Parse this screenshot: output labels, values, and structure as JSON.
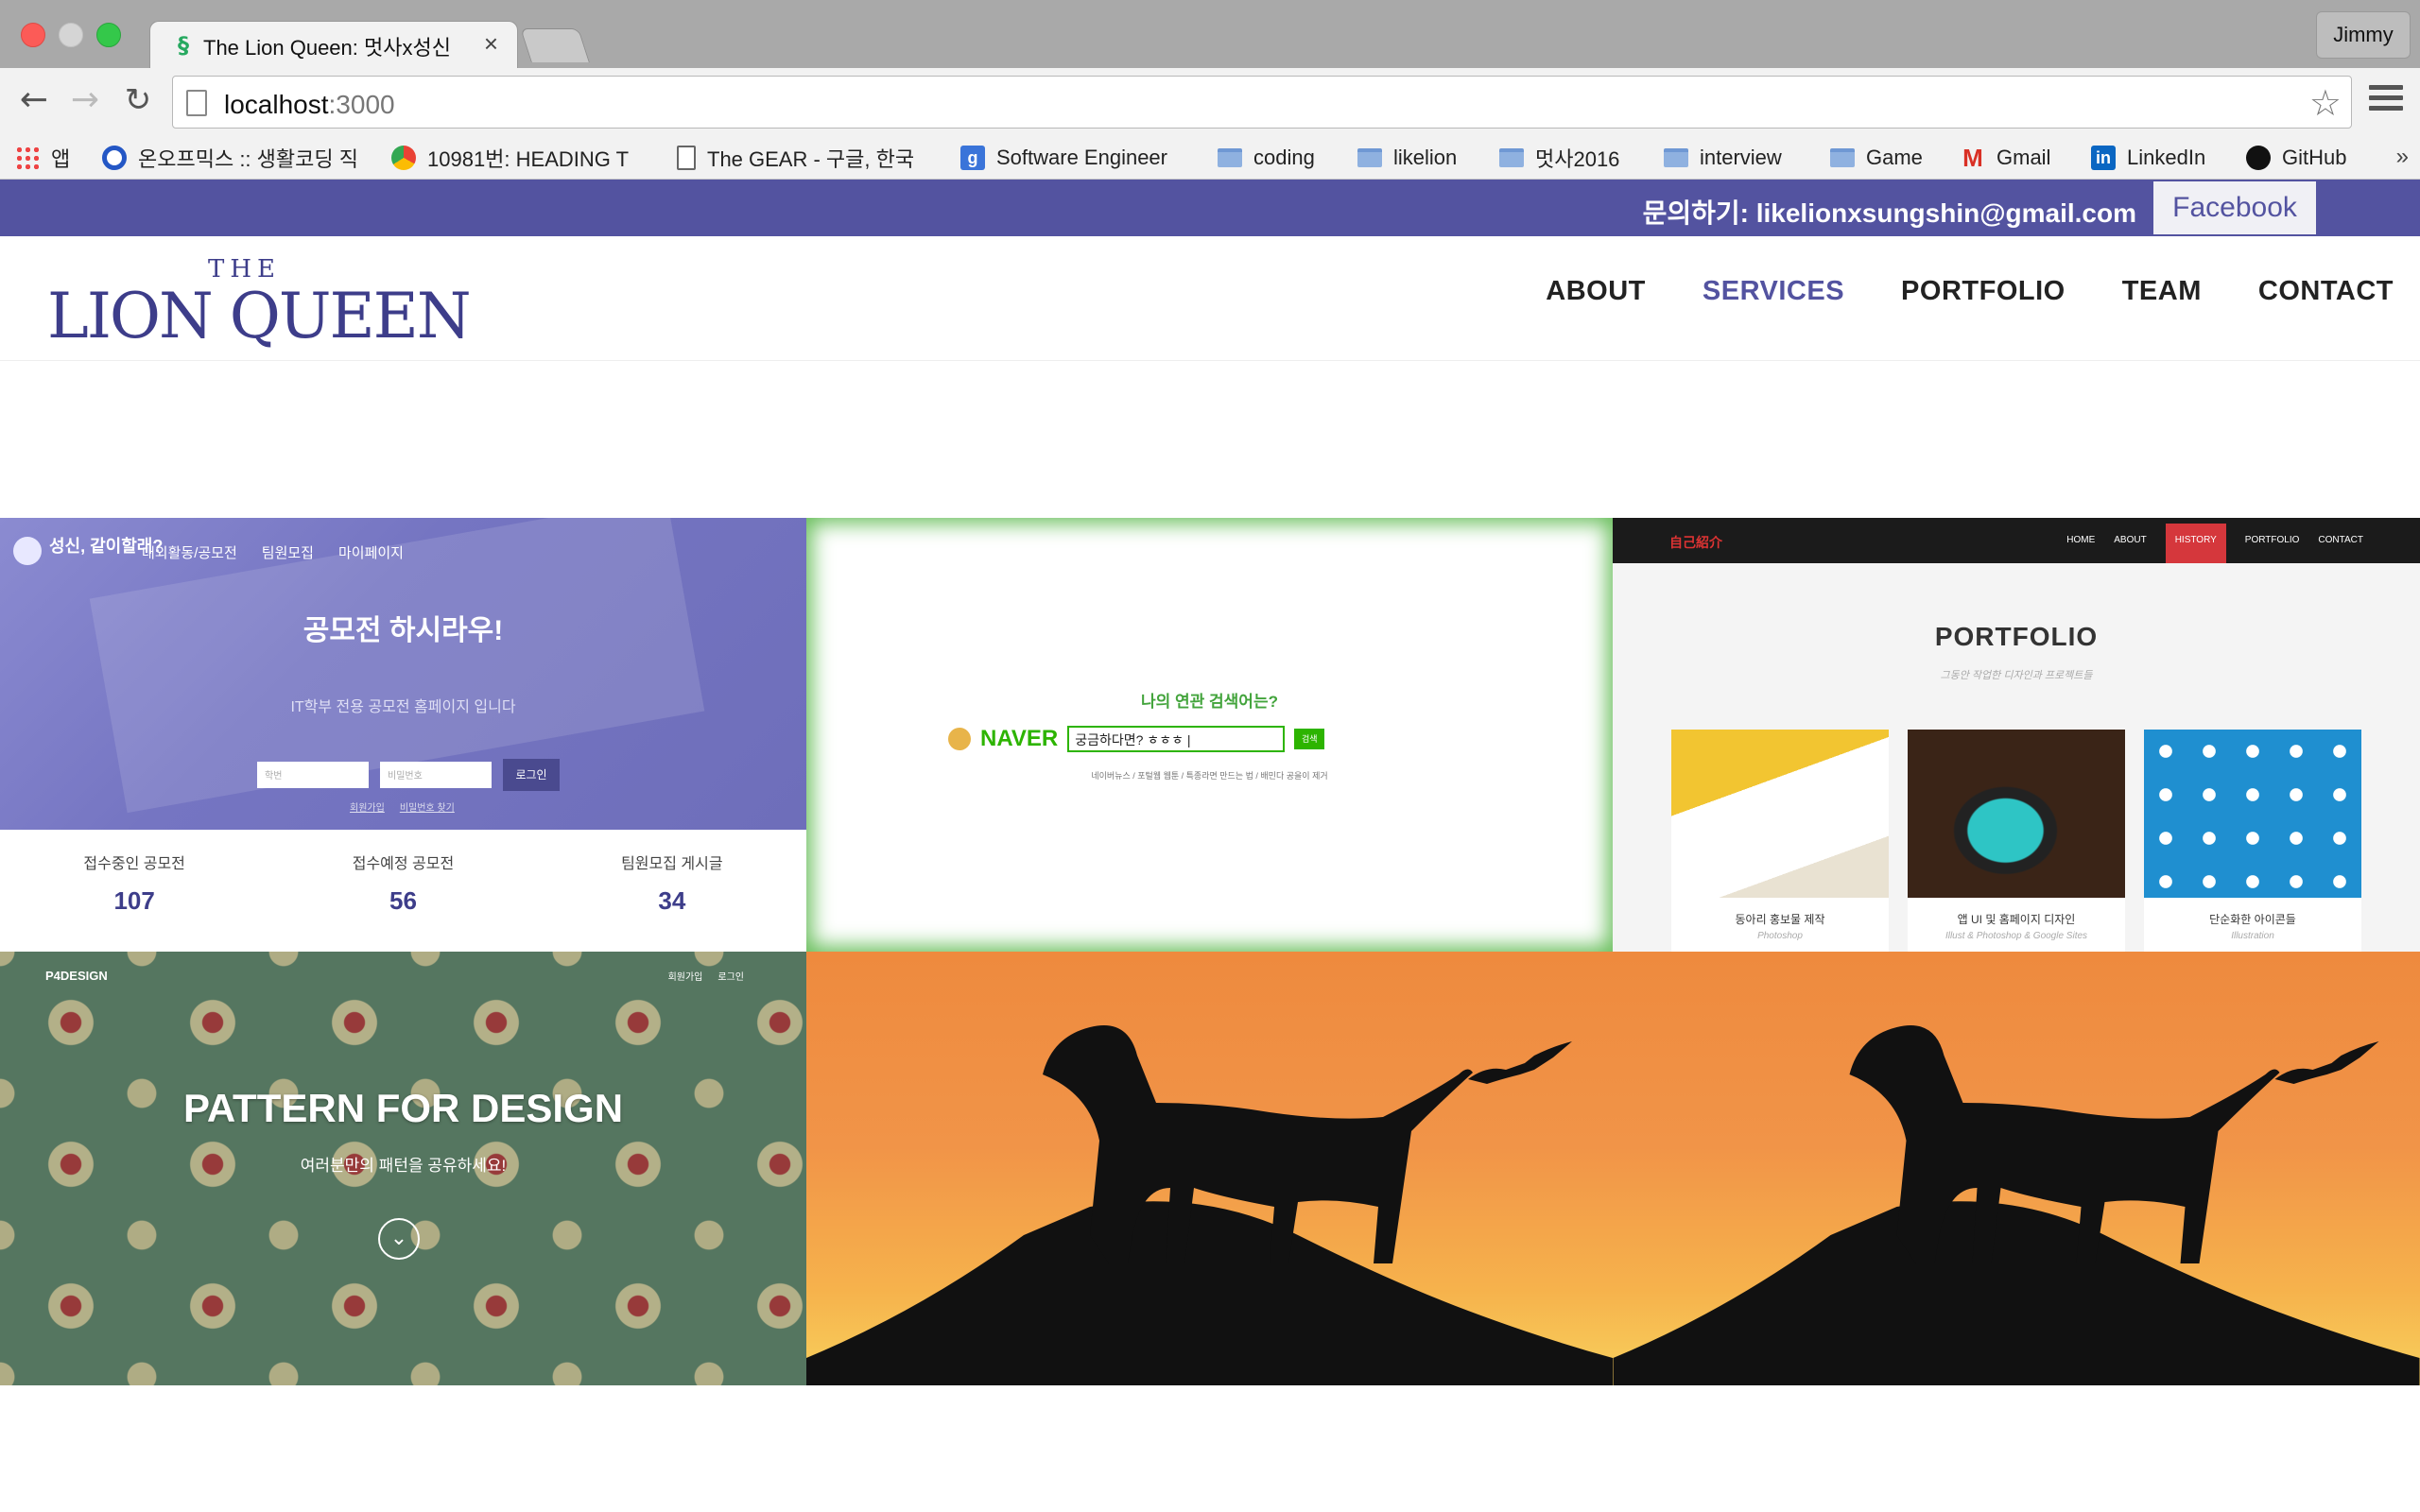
{
  "browser": {
    "tab_title": "The Lion Queen: 멋사x성신",
    "favicon_glyph": "§",
    "close_glyph": "×",
    "profile_name": "Jimmy",
    "url_host": "localhost",
    "url_port": ":3000",
    "back_glyph": "←",
    "forward_glyph": "→",
    "reload_glyph": "↻",
    "star_glyph": "☆",
    "bookmarks": [
      {
        "label": "앱",
        "icon": "apps-icon"
      },
      {
        "label": "온오프믹스 :: 생활코딩 직",
        "icon": "onoffmix-icon"
      },
      {
        "label": "10981번: HEADING T",
        "icon": "chrome-icon"
      },
      {
        "label": "The GEAR - 구글, 한국",
        "icon": "document-icon"
      },
      {
        "label": "Software Engineer",
        "icon": "software-engineer-icon"
      },
      {
        "label": "coding",
        "icon": "folder-icon"
      },
      {
        "label": "likelion",
        "icon": "folder-icon"
      },
      {
        "label": "멋사2016",
        "icon": "folder-icon"
      },
      {
        "label": "interview",
        "icon": "folder-icon"
      },
      {
        "label": "Game",
        "icon": "folder-icon"
      },
      {
        "label": "Gmail",
        "icon": "gmail-icon"
      },
      {
        "label": "LinkedIn",
        "icon": "linkedin-icon"
      },
      {
        "label": "GitHub",
        "icon": "github-icon"
      }
    ],
    "bookmarks_more": "»"
  },
  "site": {
    "topbar": {
      "contact_text": "문의하기: likelionxsungshin@gmail.com",
      "facebook_label": "Facebook",
      "color": "#5353a0"
    },
    "logo": {
      "the": "THE",
      "name": "LION QUEEN"
    },
    "nav": {
      "about": "ABOUT",
      "services": "SERVICES",
      "portfolio": "PORTFOLIO",
      "team": "TEAM",
      "contact": "CONTACT",
      "active": "SERVICES",
      "active_color": "#5353a0"
    }
  },
  "portfolio": {
    "item1": {
      "brand": "성신, 같이할래?",
      "menu": [
        "대외활동/공모전",
        "팀원모집",
        "마이페이지"
      ],
      "headline": "공모전 하시라우!",
      "subtitle": "IT학부 전용 공모전 홈페이지 입니다",
      "id_placeholder": "학번",
      "pw_placeholder": "비밀번호",
      "login_button": "로그인",
      "signup_link": "회원가입",
      "find_pw_link": "비밀번호 찾기",
      "stats": [
        {
          "label": "접수중인 공모전",
          "value": "107"
        },
        {
          "label": "접수예정 공모전",
          "value": "56"
        },
        {
          "label": "팀원모집 게시글",
          "value": "34"
        }
      ]
    },
    "item2": {
      "question": "나의 연관 검색어는?",
      "logo": "NAVER",
      "query": "궁금하다면? ㅎㅎㅎ |",
      "search_button": "검색",
      "hint": "네이버뉴스 / 포털웹 웹툰 / 특종라면 만드는 법 / 배민다 공을이 제거"
    },
    "item3": {
      "logo": "自己紹介",
      "menu": [
        "HOME",
        "ABOUT",
        "HISTORY",
        "PORTFOLIO",
        "CONTACT"
      ],
      "highlighted": "HISTORY",
      "title": "PORTFOLIO",
      "subtitle": "그동안 작업한 디자인과 프로젝트들",
      "cards": [
        {
          "title": "동아리 홍보물 제작",
          "tool": "Photoshop"
        },
        {
          "title": "앱 UI 및 홈페이지 디자인",
          "tool": "Illust & Photoshop & Google Sites"
        },
        {
          "title": "단순화한 아이콘들",
          "tool": "Illustration"
        }
      ]
    },
    "item4": {
      "brand": "P4DESIGN",
      "menu": [
        "회원가입",
        "로그인"
      ],
      "headline": "PATTERN FOR DESIGN",
      "subtitle": "여러분만의 패턴을 공유하세요!",
      "down_glyph": "⌄"
    }
  }
}
